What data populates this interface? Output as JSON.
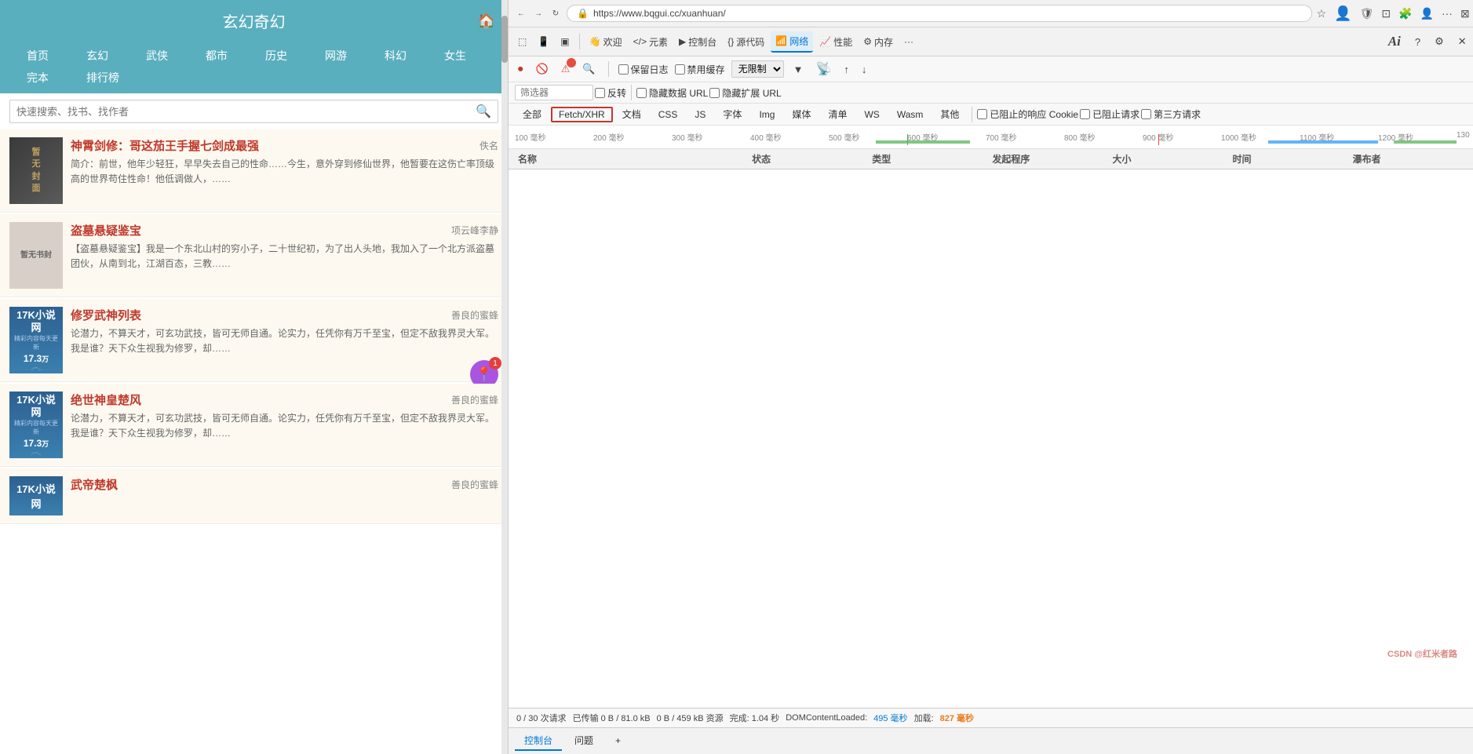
{
  "site": {
    "title": "玄幻奇幻",
    "home_icon": "🏠",
    "nav_items": [
      "首页",
      "玄幻",
      "武侠",
      "都市",
      "历史",
      "网游",
      "科幻",
      "女生",
      "完本",
      "排行榜"
    ],
    "search_placeholder": "快速搜索、找书、找作者"
  },
  "books": [
    {
      "title": "神霄剑修：哥这茄王手握七剑成最强",
      "author": "佚名",
      "cover_type": "dark",
      "cover_text": "暂无封面",
      "desc": "简介：前世，他年少轻狂，早早失去自己的性命……今生，意外穿到修仙世界，他暂要在这伤亡率顶级高的世界苟住性命！他低调做人，……"
    },
    {
      "title": "盗墓悬疑鉴宝",
      "author": "项云峰李静",
      "cover_type": "light",
      "cover_text": "暂无书封",
      "desc": "【盗墓悬疑鉴宝】我是一个东北山村的穷小子，二十世纪初，为了出人头地，我加入了一个北方派盗墓团伙，从南到北，江湖百态，三教……"
    },
    {
      "title": "修罗武神列表",
      "author": "善良的蜜蜂",
      "cover_type": "17k",
      "desc": "论潜力，不算天才，可玄功武技，皆可无师自通。论实力，任凭你有万千至宝，但定不敌我界灵大军。我是谁？天下众生视我为修罗，却……"
    },
    {
      "title": "绝世神皇楚风",
      "author": "善良的蜜蜂",
      "cover_type": "17k",
      "desc": "论潜力，不算天才，可玄功武技，皆可无师自通。论实力，任凭你有万千至宝，但定不敌我界灵大军。我是谁？天下众生视我为修罗，却……"
    },
    {
      "title": "武帝楚枫",
      "author": "善良的蜜蜂",
      "cover_type": "17k",
      "desc": ""
    }
  ],
  "devtools": {
    "tabs": [
      {
        "label": "欢迎",
        "icon": "👋"
      },
      {
        "label": "元素",
        "icon": "</>"
      },
      {
        "label": "控制台",
        "icon": "▶"
      },
      {
        "label": "源代码",
        "icon": "{}"
      },
      {
        "label": "网络",
        "icon": "📶"
      },
      {
        "label": "性能",
        "icon": "📈"
      },
      {
        "label": "内存",
        "icon": "⚙"
      },
      {
        "label": "更多",
        "icon": "···"
      }
    ],
    "active_tab": "网络",
    "network": {
      "toolbar_buttons": [
        "🔴",
        "🚫",
        "⚠",
        "🔍"
      ],
      "preserve_log_label": "保留日志",
      "disable_cache_label": "禁用缓存",
      "throttle_label": "无限制",
      "filter_placeholder": "筛选器",
      "invert_label": "反转",
      "hide_data_urls_label": "隐藏数据 URL",
      "hide_extensions_label": "隐藏扩展 URL",
      "filter_tabs": [
        "全部",
        "Fetch/XHR",
        "文档",
        "CSS",
        "JS",
        "字体",
        "Img",
        "媒体",
        "清单",
        "WS",
        "Wasm",
        "其他"
      ],
      "active_filter": "Fetch/XHR",
      "checkboxes": [
        "已阻止的响应 Cookie",
        "已阻止请求",
        "第三方请求"
      ],
      "timeline_marks": [
        "100 毫秒",
        "200 毫秒",
        "300 毫秒",
        "400 毫秒",
        "500 毫秒",
        "600 毫秒",
        "700 毫秒",
        "800 毫秒",
        "900 毫秒",
        "1000 毫秒",
        "1100 毫秒",
        "1200 毫秒",
        "130"
      ],
      "columns": [
        "名称",
        "状态",
        "类型",
        "发起程序",
        "大小",
        "时间",
        "瀑布者"
      ],
      "status_bar": {
        "requests": "0 / 30 次请求",
        "transferred": "已传输 0 B / 81.0 kB",
        "resources": "0 B / 459 kB 资源",
        "finish": "完成: 1.04 秒",
        "dom_content": "DOMContentLoaded:",
        "dom_time": "495 毫秒",
        "load": "加载:",
        "load_time": "827 毫秒"
      }
    },
    "bottom_tabs": [
      "控制台",
      "问题",
      "+"
    ],
    "ai_label": "Ai",
    "url": "https://www.bqgui.cc/xuanhuan/"
  },
  "float_badge": "1"
}
